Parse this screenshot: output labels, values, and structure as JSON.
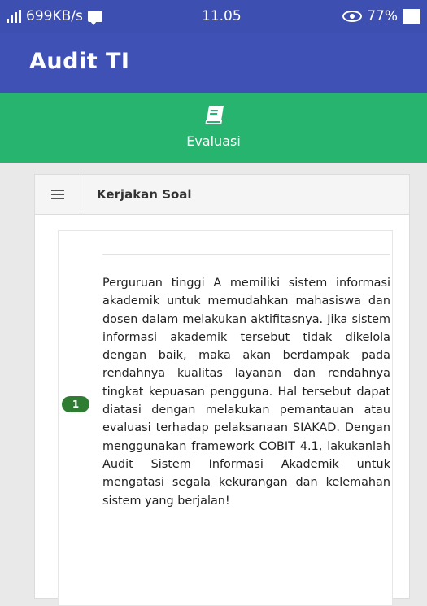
{
  "status_bar": {
    "network_speed": "699KB/s",
    "time": "11.05",
    "battery": "77%"
  },
  "app_bar": {
    "title": "Audit TI"
  },
  "section_header": {
    "label": "Evaluasi"
  },
  "card": {
    "heading": "Kerjakan Soal",
    "question": {
      "number": "1",
      "text": "Perguruan tinggi A memiliki sistem informasi akademik untuk memudahkan mahasiswa dan dosen dalam melakukan aktifitasnya. Jika sistem informasi akademik tersebut tidak dikelola dengan baik, maka akan berdampak pada rendahnya kualitas layanan dan rendahnya tingkat kepuasan pengguna. Hal tersebut dapat diatasi dengan melakukan pemantauan atau evaluasi terhadap pelaksanaan SIAKAD. Dengan menggunakan framework COBIT 4.1, lakukanlah Audit Sistem Informasi Akademik untuk mengatasi segala kekurangan dan kelemahan sistem yang berjalan!"
    }
  },
  "colors": {
    "primary": "#3f51b5",
    "status_bar": "#3d4fb1",
    "accent_green": "#26b46e",
    "badge_green": "#2e7d32"
  },
  "icons": {
    "status_left": [
      "signal-icon",
      "chat-icon"
    ],
    "status_right": [
      "eye-icon",
      "battery-icon"
    ],
    "section": "book-icon",
    "card_header": "list-icon"
  }
}
